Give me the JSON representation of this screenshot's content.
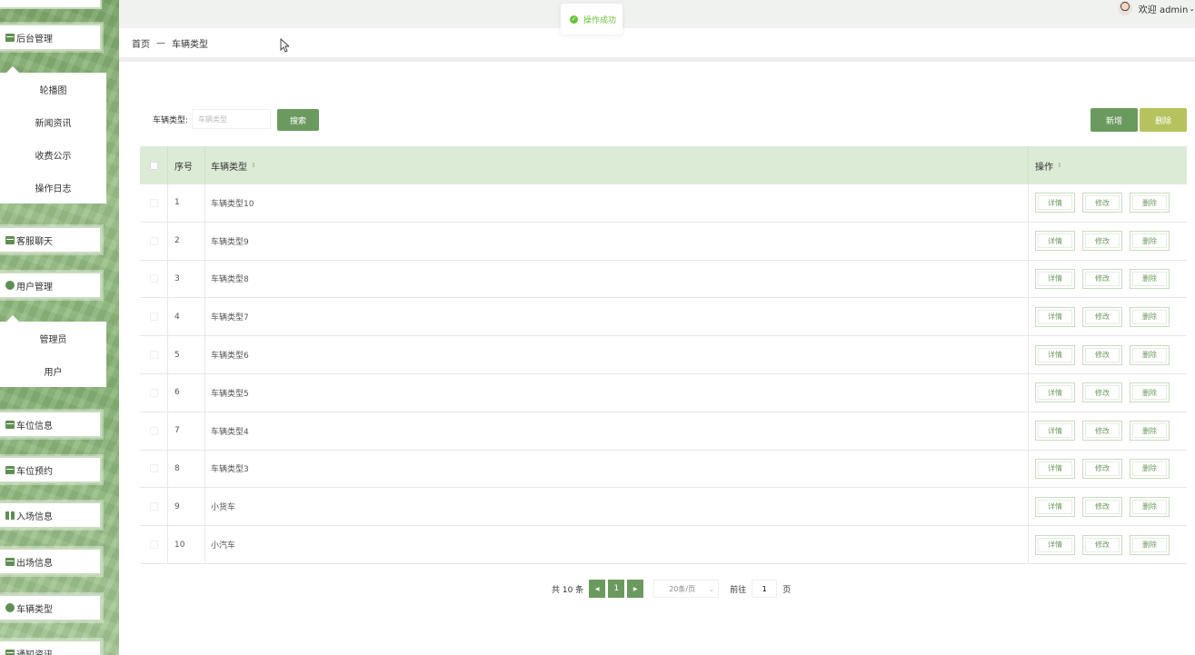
{
  "header": {
    "welcome": "欢迎 admin",
    "welcome_chevron": "⌄",
    "toast": "操作成功"
  },
  "breadcrumb": {
    "home": "首页",
    "separator": "—",
    "current": "车辆类型"
  },
  "sidebar": {
    "menus": [
      {
        "label": "后台管理",
        "icon": "folder-icon"
      },
      {
        "label": "客服聊天",
        "icon": "folder-icon"
      },
      {
        "label": "用户管理",
        "icon": "user-icon"
      },
      {
        "label": "车位信息",
        "icon": "folder-icon"
      },
      {
        "label": "车位预约",
        "icon": "car-icon"
      },
      {
        "label": "入场信息",
        "icon": "entry-icon"
      },
      {
        "label": "出场信息",
        "icon": "exit-icon"
      },
      {
        "label": "车辆类型",
        "icon": "tag-icon"
      },
      {
        "label": "通知资讯",
        "icon": "folder-icon"
      }
    ],
    "backend_sub": [
      "轮播图",
      "新闻资讯",
      "收费公示",
      "操作日志"
    ],
    "user_sub": [
      "管理员",
      "用户"
    ]
  },
  "search": {
    "label": "车辆类型:",
    "placeholder": "车辆类型",
    "button": "搜索"
  },
  "actions": {
    "add": "新增",
    "delete": "删除"
  },
  "table": {
    "columns": {
      "index": "序号",
      "type": "车辆类型",
      "ops": "操作",
      "sort_icon": "⇕"
    },
    "row_actions": {
      "detail": "详情",
      "edit": "修改",
      "delete": "删除"
    },
    "rows": [
      {
        "index": "1",
        "type": "车辆类型10"
      },
      {
        "index": "2",
        "type": "车辆类型9"
      },
      {
        "index": "3",
        "type": "车辆类型8"
      },
      {
        "index": "4",
        "type": "车辆类型7"
      },
      {
        "index": "5",
        "type": "车辆类型6"
      },
      {
        "index": "6",
        "type": "车辆类型5"
      },
      {
        "index": "7",
        "type": "车辆类型4"
      },
      {
        "index": "8",
        "type": "车辆类型3"
      },
      {
        "index": "9",
        "type": "小货车"
      },
      {
        "index": "10",
        "type": "小汽车"
      }
    ]
  },
  "pagination": {
    "total": "共 10 条",
    "prev": "◀",
    "current_page": "1",
    "next": "▶",
    "page_size": "20条/页",
    "goto_label": "前往",
    "goto_value": "1",
    "page_unit": "页"
  },
  "colors": {
    "primary": "#6b9a5e",
    "delete_button": "#b6c25e",
    "table_header": "#dcebd6",
    "toast_success": "#67c23a"
  }
}
